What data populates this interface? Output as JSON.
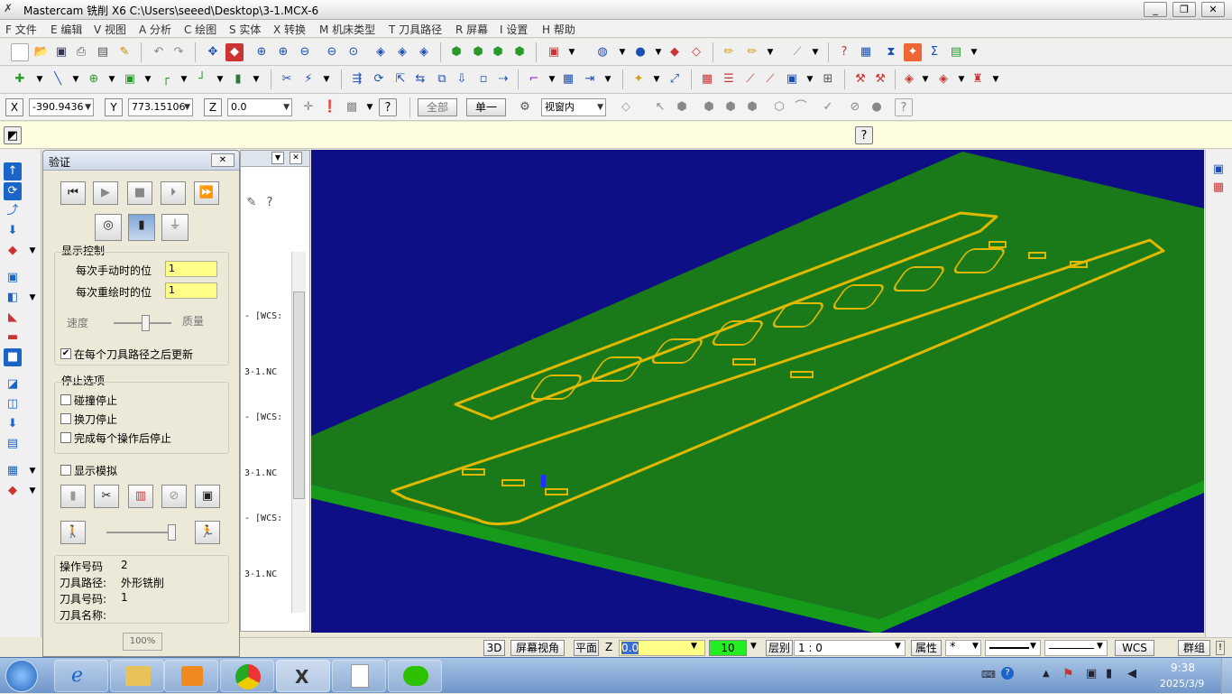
{
  "window": {
    "title": "Mastercam 铣削 X6  C:\\Users\\seeed\\Desktop\\3-1.MCX-6",
    "minimize": "_",
    "restore": "❐",
    "close": "✕"
  },
  "menu": [
    "F 文件",
    "E 编辑",
    "V 视图",
    "A 分析",
    "C 绘图",
    "S 实体",
    "X 转换",
    "M 机床类型",
    "T 刀具路径",
    "R 屏幕",
    "I 设置",
    "H 帮助"
  ],
  "coords": {
    "x_label": "X",
    "x_value": "-390.9436",
    "y_label": "Y",
    "y_value": "773.15106",
    "z_label": "Z",
    "z_value": "0.0"
  },
  "ribbon": {
    "all_btn": "全部",
    "single_btn": "单一",
    "view_combo": "视窗内"
  },
  "verify": {
    "title": "验证",
    "display_control": "显示控制",
    "manual_step_label": "每次手动时的位",
    "manual_step_value": "1",
    "redraw_step_label": "每次重绘时的位",
    "redraw_step_value": "1",
    "speed_label": "速度",
    "quality_label": "质量",
    "speed_quality": 0.55,
    "update_after_each": "在每个刀具路径之后更新",
    "update_checked": "✔",
    "stop_options": "停止选项",
    "stop_collision": "碰撞停止",
    "stop_toolchange": "换刀停止",
    "stop_each_op": "完成每个操作后停止",
    "show_sim": "显示模拟",
    "sim_speed": 0.95,
    "op_number_label": "操作号码",
    "op_number_value": "2",
    "toolpath_label": "刀具路径:",
    "toolpath_value": "外形铣削",
    "tool_number_label": "刀具号码:",
    "tool_number_value": "1",
    "tool_name_label": "刀具名称:",
    "progress": "100%"
  },
  "ops_lines": [
    "- [WCS:",
    "3-1.NC",
    "- [WCS:",
    "3-1.NC",
    "- [WCS:",
    "3-1.NC"
  ],
  "status": {
    "btn_3d": "3D",
    "screen_view": "屏幕视角",
    "plane": "平面",
    "z_label": "Z",
    "z_value": "0.0",
    "color_value": "10",
    "level_label": "层别",
    "level_value": "1 : 0",
    "attr": "属性",
    "point_style": "*",
    "wcs": "WCS",
    "group": "群组"
  },
  "taskbar": {
    "time": "9:38",
    "date": "2025/3/9"
  },
  "colors": {
    "viewport_bg": "#0e0e87",
    "stock": "#1a7a1a",
    "toolpath": "#e0b800",
    "input_yellow": "#ffff88"
  }
}
